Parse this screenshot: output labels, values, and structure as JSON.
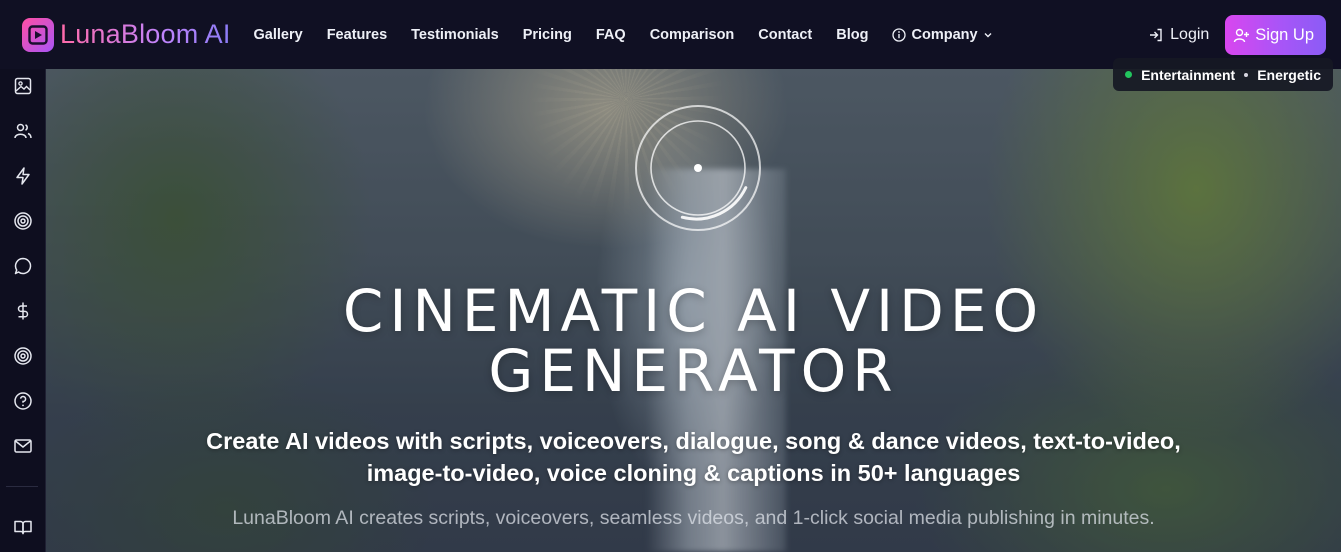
{
  "brand": {
    "name": "LunaBloom AI",
    "logo_icon": "film-play-icon"
  },
  "nav": {
    "links": [
      {
        "label": "Gallery"
      },
      {
        "label": "Features"
      },
      {
        "label": "Testimonials"
      },
      {
        "label": "Pricing"
      },
      {
        "label": "FAQ"
      },
      {
        "label": "Comparison"
      },
      {
        "label": "Contact"
      },
      {
        "label": "Blog"
      }
    ],
    "company": {
      "label": "Company",
      "icon": "info-circle-icon",
      "chevron": "chevron-down-icon"
    },
    "login": {
      "label": "Login",
      "icon": "login-arrow-icon"
    },
    "signup": {
      "label": "Sign Up",
      "icon": "user-plus-icon"
    }
  },
  "mood": {
    "tags": [
      "Entertainment",
      "Energetic"
    ],
    "active_color": "#22c55e"
  },
  "sidebar": {
    "icons": [
      "image-icon",
      "users-icon",
      "lightning-icon",
      "target-icon",
      "chat-bubble-icon",
      "dollar-icon",
      "target-icon",
      "help-circle-icon",
      "mail-icon",
      "book-open-icon"
    ]
  },
  "hero": {
    "headline_line1": "CINEMATIC AI VIDEO",
    "headline_line2": "GENERATOR",
    "subhead_line1": "Create AI videos with scripts, voiceovers, dialogue, song & dance videos, text-to-video,",
    "subhead_line2": "image-to-video, voice cloning & captions in 50+ languages",
    "tagline": "LunaBloom AI creates scripts, voiceovers, seamless videos, and 1-click social media publishing in minutes."
  },
  "colors": {
    "nav_bg": "#101023",
    "brand_gradient_start": "#ff4fa3",
    "brand_gradient_end": "#8b5cf6"
  }
}
